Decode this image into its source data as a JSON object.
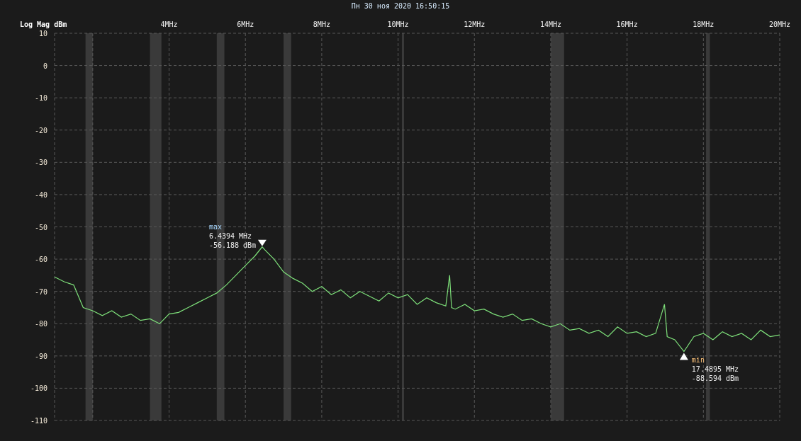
{
  "timestamp": "Пн 30 ноя 2020 16:50:15",
  "chart_data": {
    "type": "line",
    "ylabel": "Log Mag dBm",
    "grid": true,
    "xlim": [
      1,
      20
    ],
    "ylim": [
      -110,
      10
    ],
    "xticks": [
      {
        "value": 4,
        "label": "4MHz"
      },
      {
        "value": 6,
        "label": "6MHz"
      },
      {
        "value": 8,
        "label": "8MHz"
      },
      {
        "value": 10,
        "label": "10MHz"
      },
      {
        "value": 12,
        "label": "12MHz"
      },
      {
        "value": 14,
        "label": "14MHz"
      },
      {
        "value": 16,
        "label": "16MHz"
      },
      {
        "value": 18,
        "label": "18MHz"
      },
      {
        "value": 20,
        "label": "20MHz"
      }
    ],
    "yticks": [
      10,
      0,
      -10,
      -20,
      -30,
      -40,
      -50,
      -60,
      -70,
      -80,
      -90,
      -100,
      -110
    ],
    "x": [
      1,
      1.25,
      1.5,
      1.75,
      2,
      2.25,
      2.5,
      2.75,
      3,
      3.25,
      3.5,
      3.75,
      4,
      4.25,
      4.5,
      4.75,
      5,
      5.25,
      5.5,
      5.75,
      6,
      6.25,
      6.44,
      6.5,
      6.75,
      7,
      7.25,
      7.5,
      7.75,
      8,
      8.25,
      8.5,
      8.75,
      9,
      9.25,
      9.5,
      9.75,
      10,
      10.25,
      10.5,
      10.75,
      11,
      11.25,
      11.35,
      11.4,
      11.5,
      11.75,
      12,
      12.25,
      12.5,
      12.75,
      13,
      13.25,
      13.5,
      13.75,
      14,
      14.25,
      14.5,
      14.75,
      15,
      15.25,
      15.5,
      15.75,
      16,
      16.25,
      16.5,
      16.75,
      16.98,
      17.05,
      17.25,
      17.49,
      17.75,
      18,
      18.25,
      18.5,
      18.75,
      19,
      19.25,
      19.5,
      19.75,
      20
    ],
    "series": [
      {
        "color": "#7ee07a",
        "values": [
          -65.5,
          -67,
          -68,
          -75,
          -76,
          -77.5,
          -76,
          -78,
          -77,
          -79,
          -78.5,
          -80,
          -77,
          -76.5,
          -75,
          -73.5,
          -72,
          -70.5,
          -68,
          -65,
          -62,
          -59,
          -56.2,
          -57,
          -60,
          -64,
          -66,
          -67.5,
          -70,
          -68.5,
          -71,
          -69.5,
          -72,
          -70,
          -71.5,
          -73,
          -70.5,
          -72,
          -71,
          -74,
          -72,
          -73.5,
          -74.5,
          -65,
          -75,
          -75.5,
          -74,
          -76,
          -75.5,
          -77,
          -78,
          -77,
          -79,
          -78.5,
          -80,
          -81,
          -80,
          -82,
          -81.5,
          -83,
          -82,
          -84,
          -81,
          -83,
          -82.5,
          -84,
          -83,
          -74,
          -84,
          -85,
          -88.6,
          -84,
          -83,
          -85,
          -82.5,
          -84,
          -83,
          -85,
          -82,
          -84,
          -83.5
        ]
      }
    ]
  },
  "markers": [
    {
      "kind": "max",
      "label": "max",
      "lines": [
        "6.4394 MHz",
        "-56.188 dBm"
      ]
    },
    {
      "kind": "min",
      "label": "min",
      "lines": [
        "17.4895 MHz",
        "-88.594 dBm"
      ]
    }
  ]
}
